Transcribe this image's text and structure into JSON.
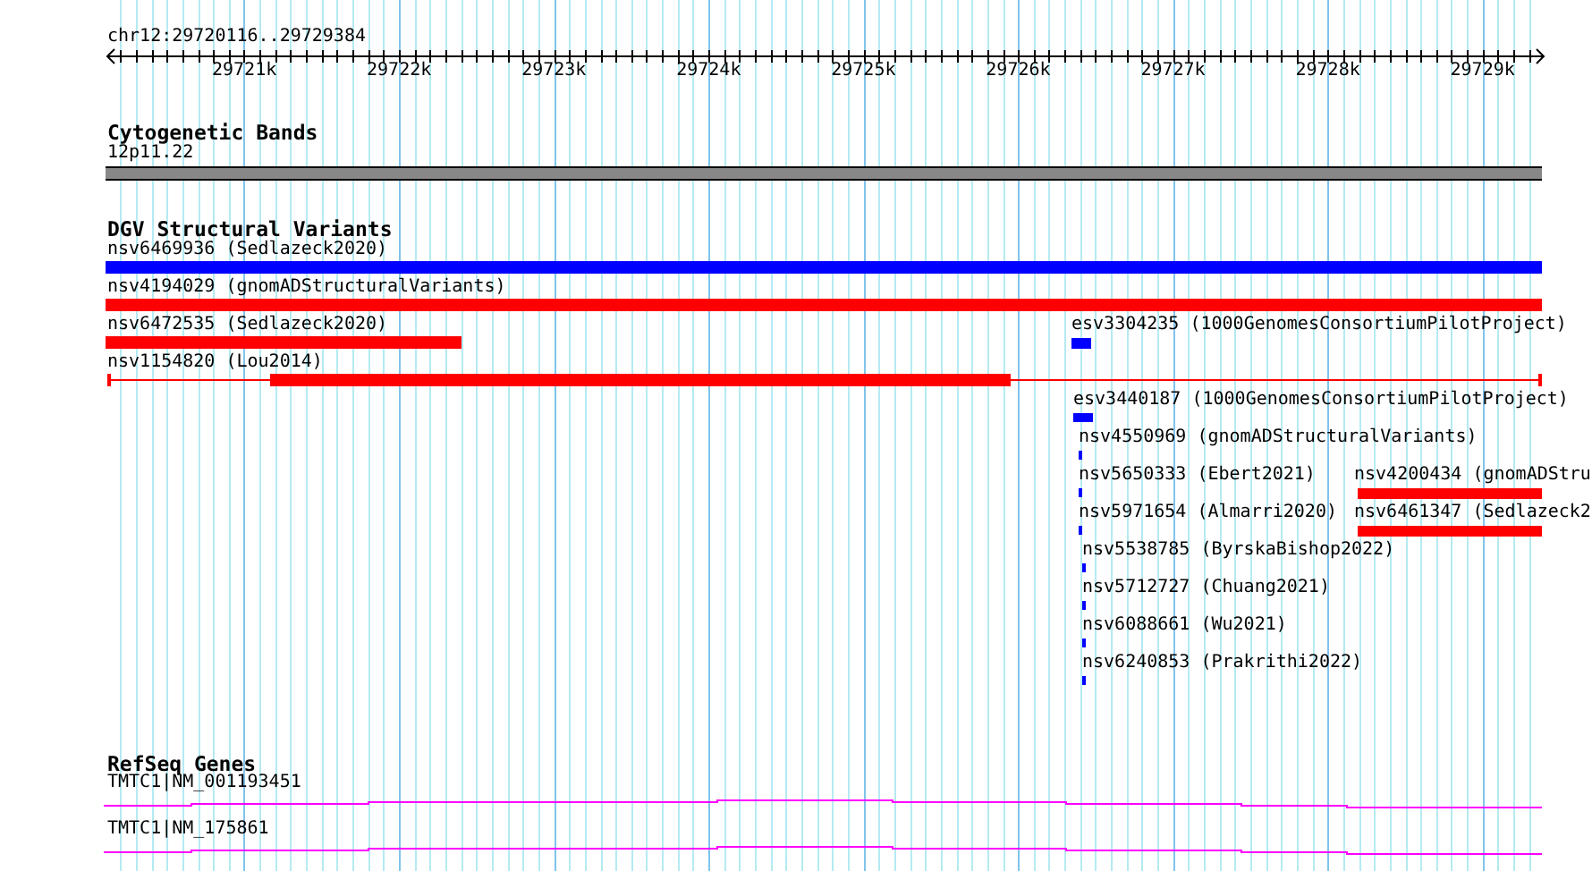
{
  "ruler": {
    "region": "chr12:29720116..29729384",
    "ticks": [
      "29721k",
      "29722k",
      "29723k",
      "29724k",
      "29725k",
      "29726k",
      "29727k",
      "29728k",
      "29729k"
    ]
  },
  "tracks": [
    {
      "title": "Cytogenetic Bands",
      "kind": "bands",
      "features": [
        {
          "label": "12p11.22"
        }
      ]
    },
    {
      "title": "DGV Structural Variants",
      "kind": "variants",
      "features": [
        {
          "label": "nsv6469936 (Sedlazeck2020)",
          "color": "#0000ff"
        },
        {
          "label": "nsv4194029 (gnomADStructuralVariants)",
          "color": "#ff0000"
        },
        {
          "label": "nsv6472535 (Sedlazeck2020)",
          "color": "#ff0000"
        },
        {
          "label": "esv3304235 (1000GenomesConsortiumPilotProject)",
          "color": "#0000ff"
        },
        {
          "label": "nsv1154820 (Lou2014)",
          "color": "#ff0000"
        },
        {
          "label": "esv3440187 (1000GenomesConsortiumPilotProject)",
          "color": "#0000ff"
        },
        {
          "label": "nsv4550969 (gnomADStructuralVariants)",
          "color": "#0000ff"
        },
        {
          "label": "nsv5650333 (Ebert2021)",
          "color": "#0000ff"
        },
        {
          "label": "nsv4200434 (gnomADStru",
          "color": "#ff0000"
        },
        {
          "label": "nsv5971654 (Almarri2020)",
          "color": "#0000ff"
        },
        {
          "label": "nsv6461347 (Sedlazeck2",
          "color": "#ff0000"
        },
        {
          "label": "nsv5538785 (ByrskaBishop2022)",
          "color": "#0000ff"
        },
        {
          "label": "nsv5712727 (Chuang2021)",
          "color": "#0000ff"
        },
        {
          "label": "nsv6088661 (Wu2021)",
          "color": "#0000ff"
        },
        {
          "label": "nsv6240853 (Prakrithi2022)",
          "color": "#0000ff"
        }
      ]
    },
    {
      "title": "RefSeq Genes",
      "kind": "genes",
      "features": [
        {
          "label": "TMTC1|NM_001193451"
        },
        {
          "label": "TMTC1|NM_175861"
        }
      ]
    }
  ]
}
